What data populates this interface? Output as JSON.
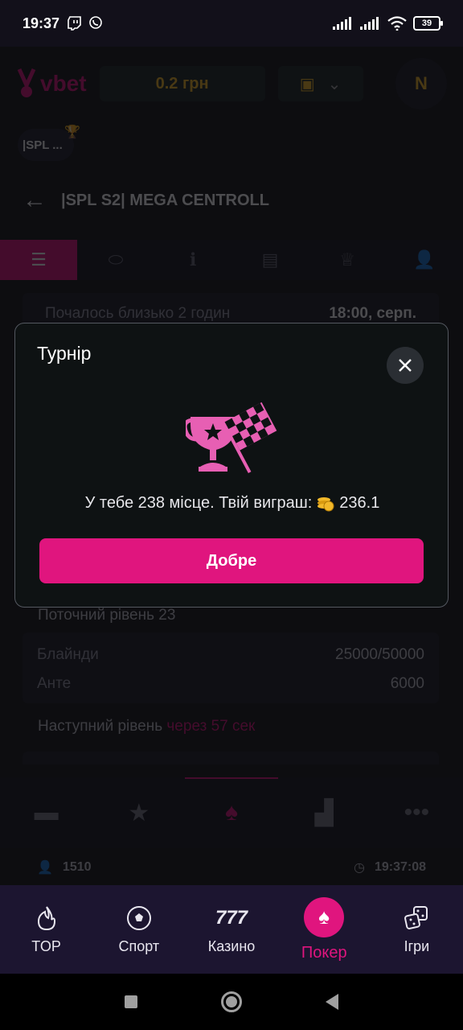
{
  "status_bar": {
    "time": "19:37",
    "battery": "39"
  },
  "header": {
    "logo_text": "vbet",
    "balance": "0.2 грн",
    "avatar_text": "N"
  },
  "tournament": {
    "chip_label": "|SPL ...",
    "title": "|SPL S2| MEGA CENTROLL"
  },
  "tabs": [
    {
      "icon": "list-icon",
      "active": true
    },
    {
      "icon": "table-icon",
      "active": false
    },
    {
      "icon": "info-icon",
      "active": false
    },
    {
      "icon": "structure-icon",
      "active": false
    },
    {
      "icon": "trophy-icon",
      "active": false
    },
    {
      "icon": "player-icon",
      "active": false
    }
  ],
  "info": {
    "started": "Почалось близько 2 годин",
    "start_time": "18:00, серп."
  },
  "level": {
    "current_label": "Поточний рівень 23",
    "blinds_label": "Блайнди",
    "blinds_value": "25000/50000",
    "ante_label": "Анте",
    "ante_value": "6000",
    "next_label": "Наступний рівень",
    "next_in": "через 57 сек"
  },
  "info_bar": {
    "players": "1510",
    "clock": "19:37:08"
  },
  "modal": {
    "title": "Турнір",
    "result_text": "У тебе 238 місце. Твій виграш:",
    "prize": "236.1",
    "ok_label": "Добре"
  },
  "bottom_nav": [
    {
      "label": "TOP",
      "icon": "flame-icon"
    },
    {
      "label": "Спорт",
      "icon": "soccer-ball-icon"
    },
    {
      "label": "Казино",
      "icon": "slots-777-icon"
    },
    {
      "label": "Покер",
      "icon": "spade-icon"
    },
    {
      "label": "Ігри",
      "icon": "dice-icon"
    }
  ],
  "colors": {
    "accent": "#e0157e",
    "gold": "#f2b829",
    "nav_bg": "#1c1530"
  }
}
